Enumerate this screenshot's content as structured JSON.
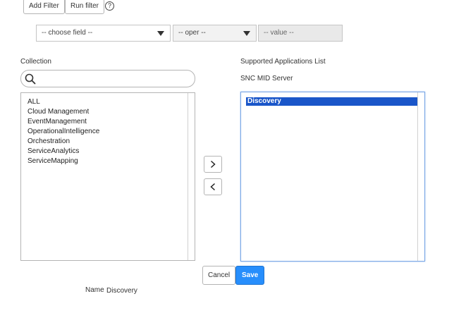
{
  "filter": {
    "add_filter_label": "Add Filter",
    "run_filter_label": "Run filter",
    "help_glyph": "?",
    "field_select": "-- choose field --",
    "oper_select": "-- oper --",
    "value_placeholder": "-- value --"
  },
  "collection": {
    "label": "Collection",
    "search_value": "",
    "items": [
      "ALL",
      "Cloud Management",
      "EventManagement",
      "OperationalIntelligence",
      "Orchestration",
      "ServiceAnalytics",
      "ServiceMapping"
    ]
  },
  "supported": {
    "label": "Supported Applications List",
    "sublabel": "SNC MID Server",
    "items": [
      "Discovery"
    ]
  },
  "actions": {
    "cancel_label": "Cancel",
    "save_label": "Save"
  },
  "footer": {
    "name_label": "Name",
    "name_value": "Discovery"
  },
  "icons": {
    "help": "help-icon",
    "search": "search-icon",
    "add": "chevron-right-icon",
    "remove": "chevron-left-icon",
    "dropdown": "chevron-down-icon"
  },
  "colors": {
    "accent": "#278efc",
    "selection": "#1a56c9",
    "focus_border": "#7aa7e6"
  }
}
